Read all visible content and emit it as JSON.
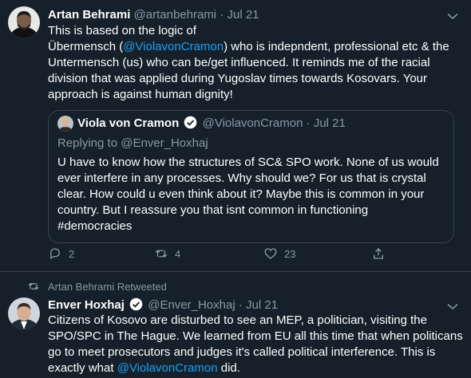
{
  "tweet1": {
    "name": "Artan Behrami",
    "handle": "@artanbehrami",
    "sep": "·",
    "date": "Jul 21",
    "line1": "This is based on the logic of",
    "line2_pre": "Übermensch (",
    "line2_link": "@ViolavonCramon",
    "line2_post": ") who is indepndent, professional etc & the",
    "line3": "Untermensch (us) who can be/get influenced. It reminds me of the racial",
    "line4": "division that was applied during Yugoslav times towards Kosovars. Your",
    "line5": "approach is against human dignity!",
    "quote": {
      "name": "Viola von Cramon",
      "handle": "@ViolavonCramon",
      "sep": "·",
      "date": "Jul 21",
      "replying_to": "Replying to @Enver_Hoxhaj",
      "line1": "U have to know how the structures of SC& SPO work. None of us would",
      "line2": "ever interfere in any processes. Why should we? For us that is crystal",
      "line3": "clear. How could u even think about it? Maybe this is common in your",
      "line4": "country. But I reassure you that isnt common in functioning",
      "line5": "#democracies"
    },
    "actions": {
      "replies": "2",
      "retweets": "4",
      "likes": "23"
    }
  },
  "retweet_label": "Artan Behrami Retweeted",
  "tweet2": {
    "name": "Enver Hoxhaj",
    "handle": "@Enver_Hoxhaj",
    "sep": "·",
    "date": "Jul 21",
    "line1": "Citizens of Kosovo are disturbed to see an MEP, a politician, visiting the",
    "line2": "SPO/SPC in The Hague. We learned from EU all this time that when politicans",
    "line3": "go to meet prosecutors and judges it's called political interference. This is",
    "line4_pre": "exactly what ",
    "line4_link": "@ViolavonCramon",
    "line4_post": " did."
  },
  "colors": {
    "background": "#15202b",
    "accent": "#1da1f2",
    "muted": "#8899a6",
    "border": "#38444d"
  }
}
